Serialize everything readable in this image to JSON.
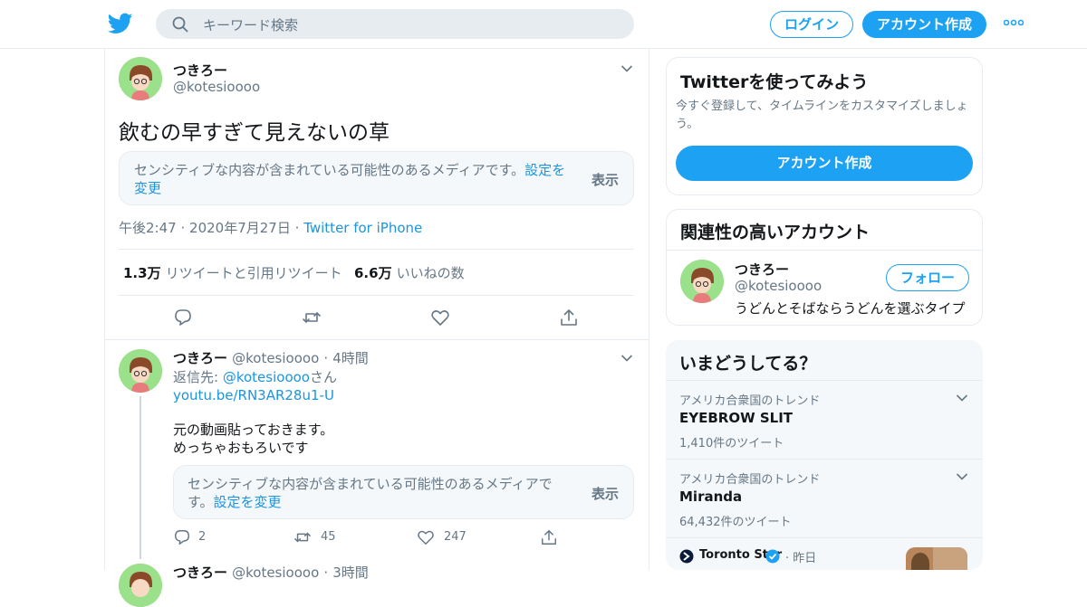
{
  "header": {
    "search_placeholder": "キーワード検索",
    "login_label": "ログイン",
    "signup_label": "アカウント作成",
    "brand_color": "#1da1f2"
  },
  "tweet": {
    "name": "つきろー",
    "handle": "@kotesioooo",
    "text": "飲むの早すぎて見えないの草",
    "sensitive_msg": "センシティブな内容が含まれている可能性のあるメディアです。",
    "sensitive_link": "設定を変更",
    "show_label": "表示",
    "time": "午後2:47",
    "date": "2020年7月27日",
    "source": "Twitter for iPhone",
    "retweets_count": "1.3万",
    "retweets_label": "リツイートと引用リツイート",
    "likes_count": "6.6万",
    "likes_label": "いいねの数"
  },
  "reply": {
    "name": "つきろー",
    "handle": "@kotesioooo",
    "time": "4時間",
    "reply_to_prefix": "返信先:",
    "reply_to_handle": "@kotesioooo",
    "reply_to_suffix": "さん",
    "link": "youtu.be/RN3AR28u1-U",
    "line1": "元の動画貼っておきます。",
    "line2": "めっちゃおもろいです",
    "sensitive_msg_1": "センシティブな内容が含まれている可能性のあるメディアで",
    "sensitive_msg_2": "す。",
    "sensitive_link": "設定を変更",
    "show_label": "表示",
    "reply_count": "2",
    "retweet_count": "45",
    "like_count": "247"
  },
  "next_reply": {
    "name": "つきろー",
    "handle": "@kotesioooo",
    "time": "3時間"
  },
  "sidebar": {
    "signup_card": {
      "title": "Twitterを使ってみよう",
      "subtitle": "今すぐ登録して、タイムラインをカスタマイズしましょう。",
      "button": "アカウント作成"
    },
    "related_card": {
      "title": "関連性の高いアカウント",
      "name": "つきろー",
      "handle": "@kotesioooo",
      "bio": "うどんとそばならうどんを選ぶタイプ",
      "follow_label": "フォロー"
    },
    "trends_card": {
      "title": "いまどうしてる？",
      "trends": [
        {
          "context": "アメリカ合衆国のトレンド",
          "name": "EYEBROW SLIT",
          "count": "1,410件のツイート"
        },
        {
          "context": "アメリカ合衆国のトレンド",
          "name": "Miranda",
          "count": "64,432件のツイート"
        }
      ],
      "news_source": "Toronto Star",
      "news_time": "昨日"
    }
  }
}
